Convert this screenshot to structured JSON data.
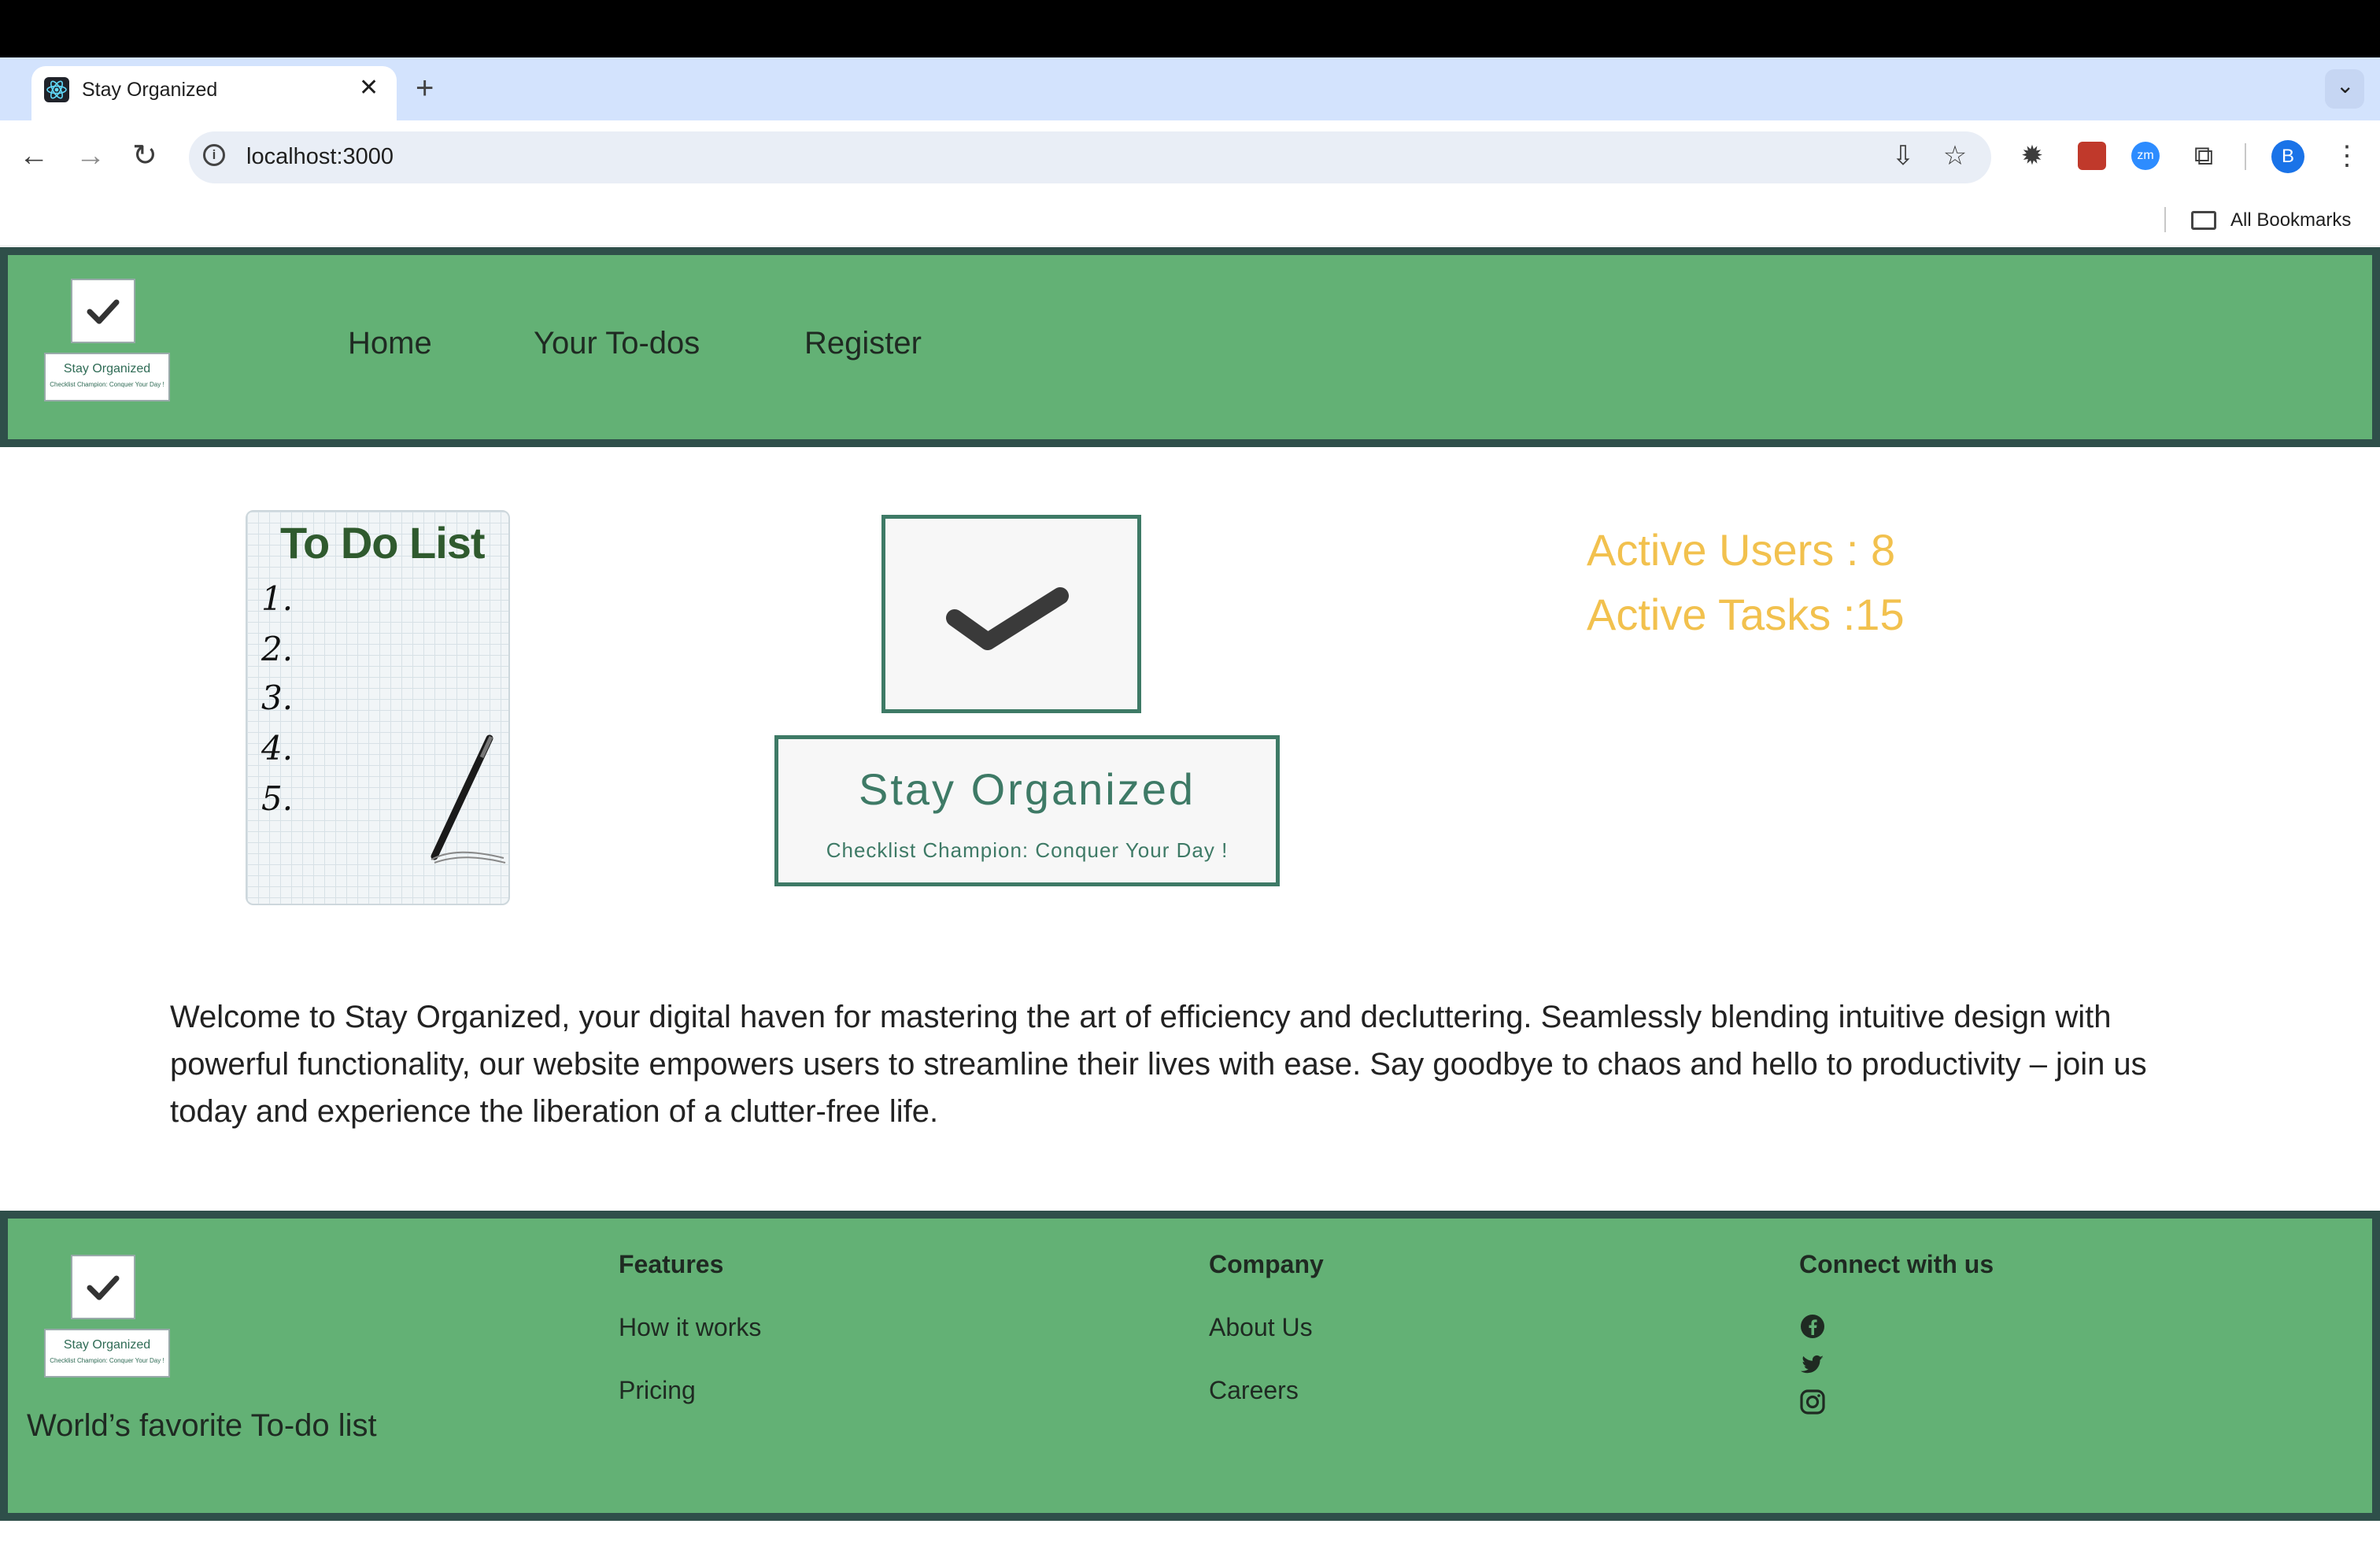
{
  "browser": {
    "tab_title": "Stay Organized",
    "tab_close": "✕",
    "new_tab": "+",
    "tab_menu": "⌄",
    "url": "localhost:3000",
    "back": "←",
    "forward": "→",
    "reload": "↻",
    "info": "i",
    "install_icon": "⇩",
    "star_icon": "☆",
    "ext_zoom_label": "zm",
    "extensions_icon": "⧉",
    "profile_initial": "B",
    "menu_icon": "⋮",
    "bookmarks_label": "All Bookmarks",
    "sun_icon": "✹"
  },
  "header": {
    "logo_title": "Stay Organized",
    "logo_tagline": "Checklist Champion: Conquer Your Day !",
    "nav": [
      "Home",
      "Your To-dos",
      "Register"
    ]
  },
  "hero": {
    "todo_title": "To Do List",
    "todo_items": [
      "1.",
      "2.",
      "3.",
      "4.",
      "5."
    ],
    "brand_title": "Stay Organized",
    "brand_tagline": "Checklist Champion: Conquer Your Day !",
    "active_users": "Active Users : 8",
    "active_tasks": "Active Tasks :15"
  },
  "welcome_text": "Welcome to Stay Organized, your digital haven for mastering the art of efficiency and decluttering. Seamlessly blending intuitive design with powerful functionality, our website empowers users to streamline their lives with ease. Say goodbye to chaos and hello to productivity – join us today and experience the liberation of a clutter-free life.",
  "footer": {
    "tagline": "World’s favorite To-do list",
    "logo_title": "Stay Organized",
    "logo_tagline": "Checklist Champion: Conquer Your Day !",
    "features_heading": "Features",
    "features_links": [
      "How it works",
      "Pricing"
    ],
    "company_heading": "Company",
    "company_links": [
      "About Us",
      "Careers"
    ],
    "connect_heading": "Connect with us",
    "social_icons": [
      "facebook-icon",
      "twitter-icon",
      "instagram-icon"
    ]
  },
  "colors": {
    "header_green": "#63b175",
    "border_dark": "#2f4f4a",
    "stat_gold": "#f2c14e",
    "brand_teal": "#3e7a66"
  }
}
